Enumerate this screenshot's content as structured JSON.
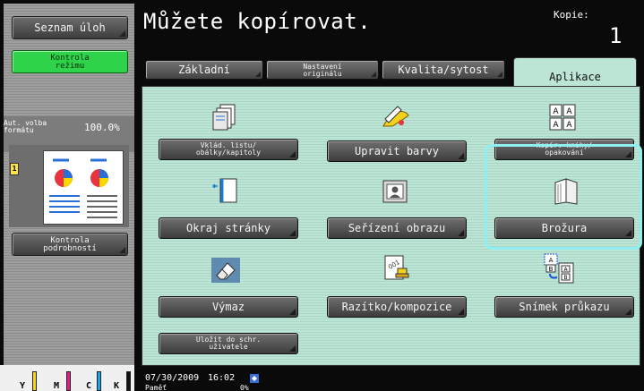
{
  "left_panel": {
    "task_list_label": "Seznam úloh",
    "mode_check_label": "Kontrola\nrežimu",
    "zoom_label": "Aut. volba\nformátu",
    "zoom_value": "100.0%",
    "original_indicator": "1",
    "detail_check_label": "Kontrola\npodrobností",
    "toner": [
      {
        "label": "Y",
        "color": "#f5d800"
      },
      {
        "label": "M",
        "color": "#e0208a"
      },
      {
        "label": "C",
        "color": "#1aa6e6"
      },
      {
        "label": "K",
        "color": "#111111"
      }
    ]
  },
  "header": {
    "title": "Můžete kopírovat.",
    "copies_label": "Kopie:",
    "copies_value": "1"
  },
  "tabs": {
    "basic": "Základní",
    "original_settings": "Nastavení\noriginálu",
    "quality": "Kvalita/sytost",
    "applications": "Aplikace"
  },
  "functions": {
    "insert_sheet": "Vklád. listu/\nobálky/kapitoly",
    "edit_color": "Upravit barvy",
    "book_copy": "Kopír. knihy/\nopakování",
    "page_margin": "Okraj stránky",
    "image_adjust": "Seřízení obrazu",
    "booklet": "Brožura",
    "erase": "Výmaz",
    "stamp": "Razítko/kompozice",
    "card_shot": "Snímek průkazu",
    "save_box": "Uložit do schr.\nuživatele"
  },
  "status": {
    "date": "07/30/2009",
    "time": "16:02",
    "memory_label": "Paměť",
    "memory_value": "0%"
  },
  "colors": {
    "main_bg": "#bde5d6",
    "highlight": "#8ff0f4",
    "mode_button": "#2fd34a"
  }
}
